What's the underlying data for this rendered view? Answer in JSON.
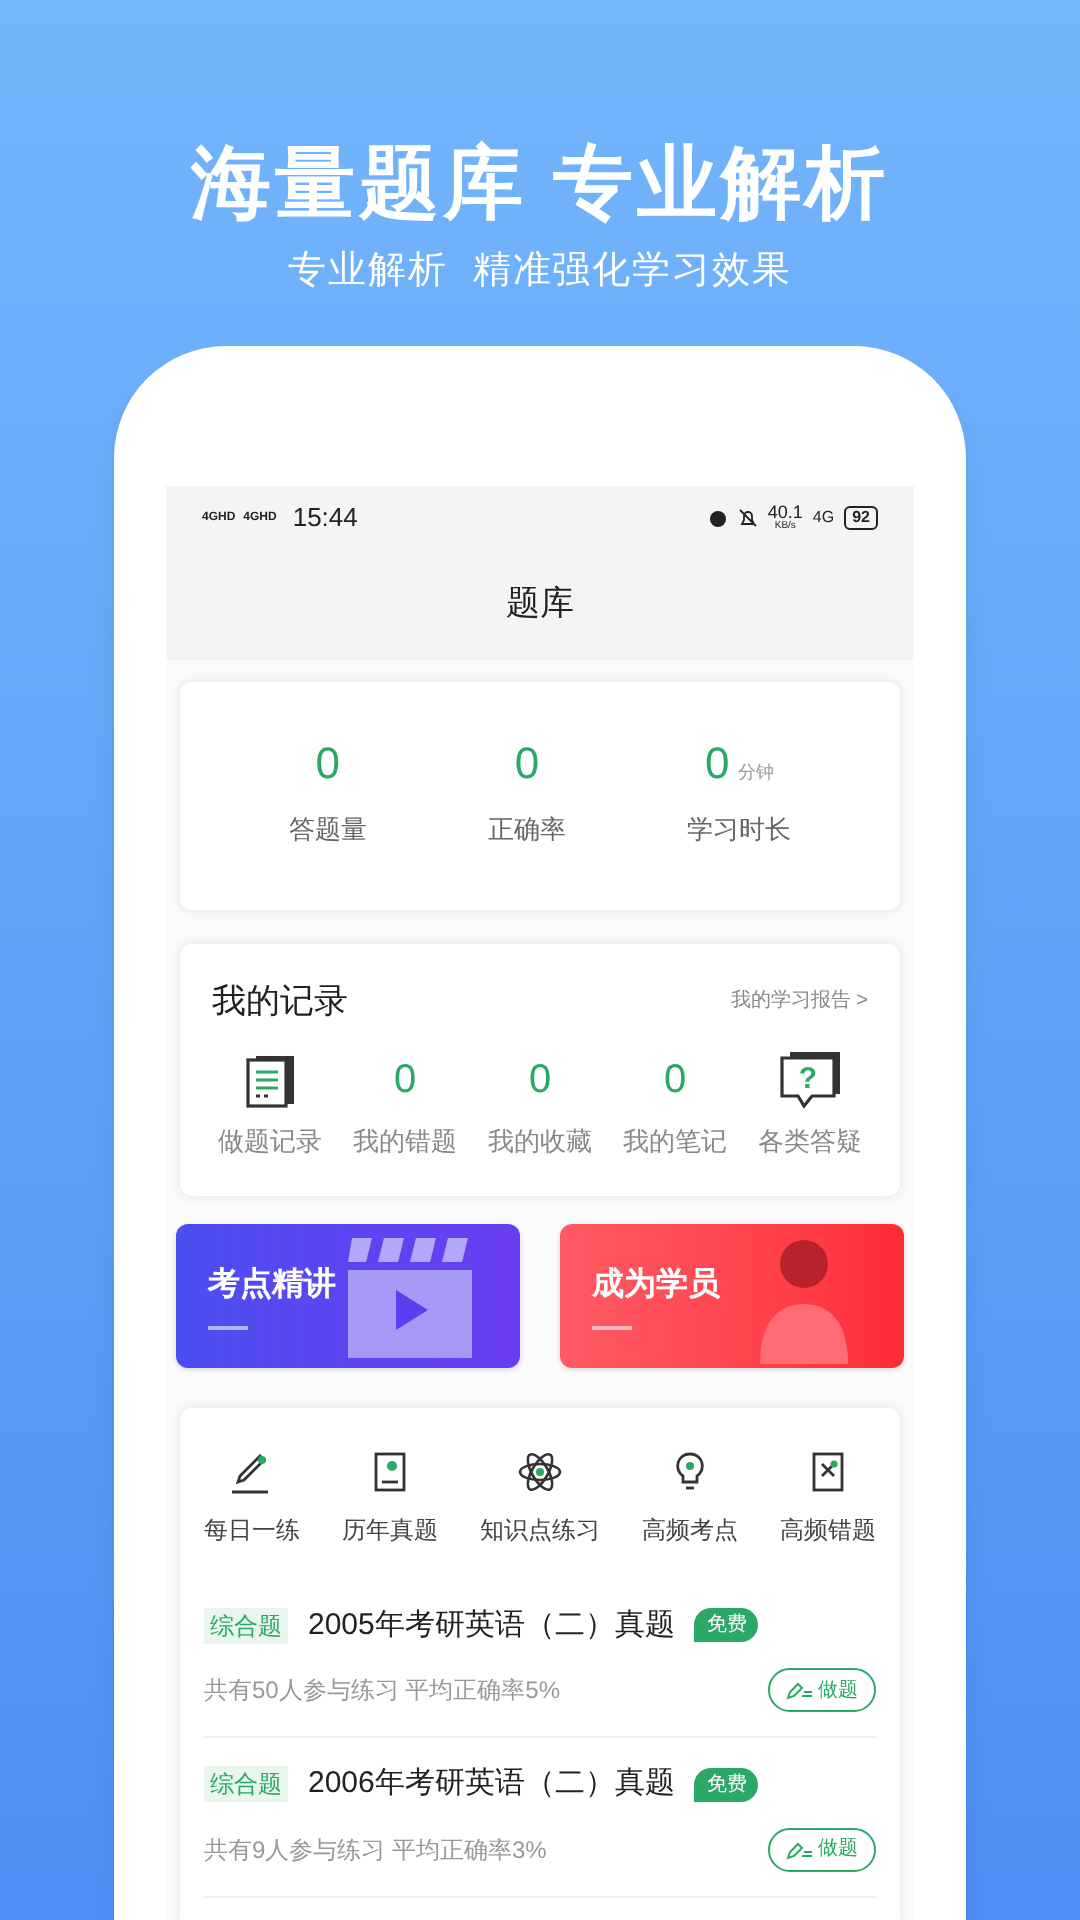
{
  "headline": "海量题库 专业解析",
  "subheadline": "专业解析  精准强化学习效果",
  "status_bar": {
    "signal_labels": [
      "4GHD",
      "4GHD"
    ],
    "time": "15:44",
    "net_speed": "40.1",
    "net_unit": "KB/s",
    "network": "4G",
    "battery": "92"
  },
  "title": "题库",
  "stats": [
    {
      "value": "0",
      "label": "答题量"
    },
    {
      "value": "0",
      "label": "正确率"
    },
    {
      "value": "0",
      "unit": "分钟",
      "label": "学习时长"
    }
  ],
  "records": {
    "title": "我的记录",
    "report_link": "我的学习报告 >",
    "items": [
      {
        "kind": "icon",
        "label": "做题记录"
      },
      {
        "kind": "count",
        "value": "0",
        "label": "我的错题"
      },
      {
        "kind": "count",
        "value": "0",
        "label": "我的收藏"
      },
      {
        "kind": "count",
        "value": "0",
        "label": "我的笔记"
      },
      {
        "kind": "icon",
        "glyph": "?",
        "label": "各类答疑"
      }
    ]
  },
  "banners": [
    {
      "label": "考点精讲"
    },
    {
      "label": "成为学员"
    }
  ],
  "shortcuts": [
    {
      "label": "每日一练"
    },
    {
      "label": "历年真题"
    },
    {
      "label": "知识点练习"
    },
    {
      "label": "高频考点"
    },
    {
      "label": "高频错题"
    }
  ],
  "exams": [
    {
      "tag": "综合题",
      "title": "2005年考研英语（二）真题",
      "badge": "免费",
      "stats": "共有50人参与练习 平均正确率5%",
      "action": "做题"
    },
    {
      "tag": "综合题",
      "title": "2006年考研英语（二）真题",
      "badge": "免费",
      "stats": "共有9人参与练习 平均正确率3%",
      "action": "做题"
    }
  ]
}
